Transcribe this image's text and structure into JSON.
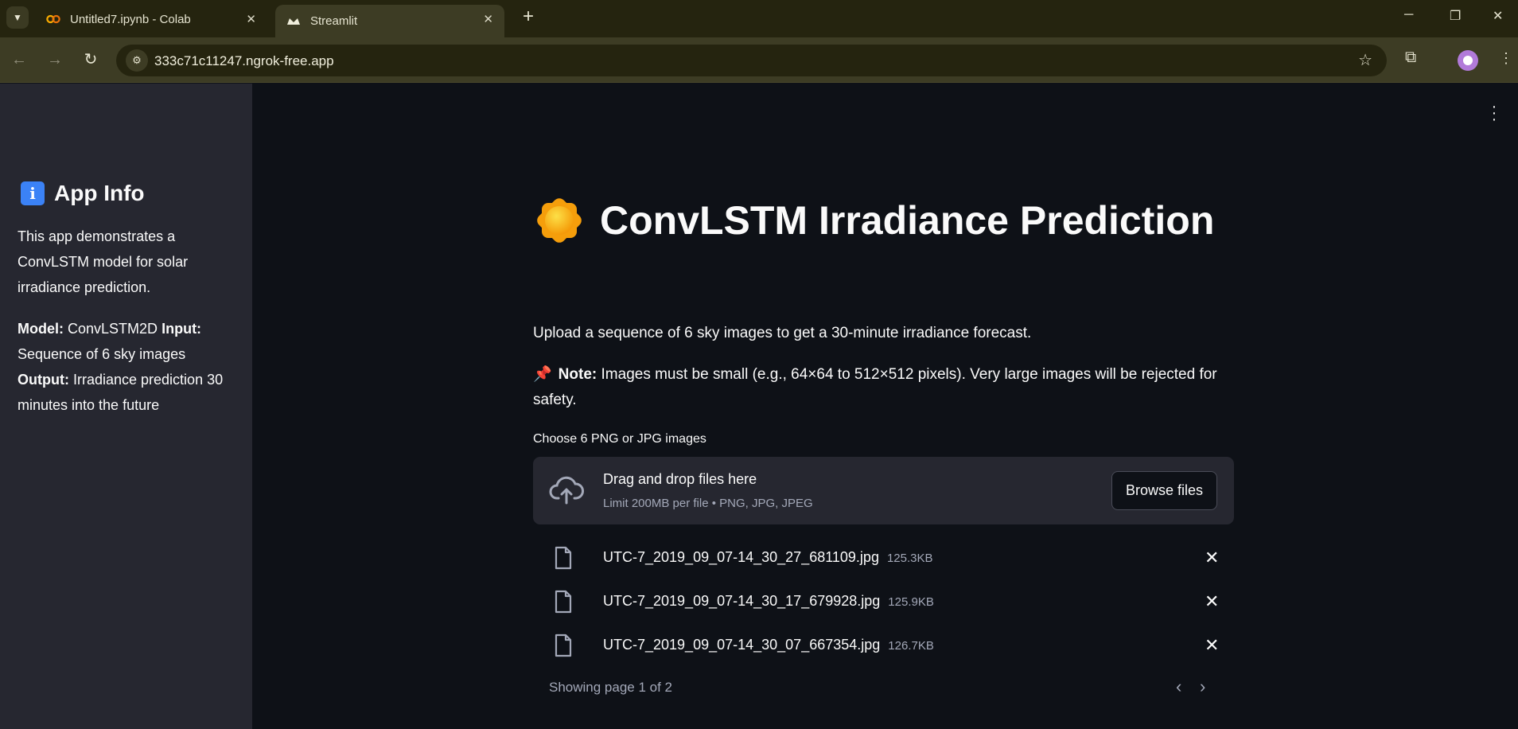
{
  "browser": {
    "tabs": [
      {
        "title": "Untitled7.ipynb - Colab",
        "active": false,
        "icon": "colab-icon"
      },
      {
        "title": "Streamlit",
        "active": true,
        "icon": "streamlit-icon"
      }
    ],
    "url": "333c71c11247.ngrok-free.app"
  },
  "sidebar": {
    "title": "App Info",
    "description": "This app demonstrates a ConvLSTM model for solar irradiance prediction.",
    "model_label": "Model:",
    "model_value": "ConvLSTM2D",
    "input_label": "Input:",
    "input_value": "Sequence of 6 sky images",
    "output_label": "Output:",
    "output_value": "Irradiance prediction 30 minutes into the future"
  },
  "main": {
    "title": "ConvLSTM Irradiance Prediction",
    "intro": "Upload a sequence of 6 sky images to get a 30-minute irradiance forecast.",
    "note_label": "Note:",
    "note_text": "Images must be small (e.g., 64×64 to 512×512 pixels). Very large images will be rejected for safety.",
    "uploader": {
      "label": "Choose 6 PNG or JPG images",
      "drop_title": "Drag and drop files here",
      "drop_sub": "Limit 200MB per file • PNG, JPG, JPEG",
      "browse_label": "Browse files"
    },
    "files": [
      {
        "name": "UTC-7_2019_09_07-14_30_27_681109.jpg",
        "size": "125.3KB"
      },
      {
        "name": "UTC-7_2019_09_07-14_30_17_679928.jpg",
        "size": "125.9KB"
      },
      {
        "name": "UTC-7_2019_09_07-14_30_07_667354.jpg",
        "size": "126.7KB"
      }
    ],
    "pagination": "Showing page 1 of 2"
  }
}
